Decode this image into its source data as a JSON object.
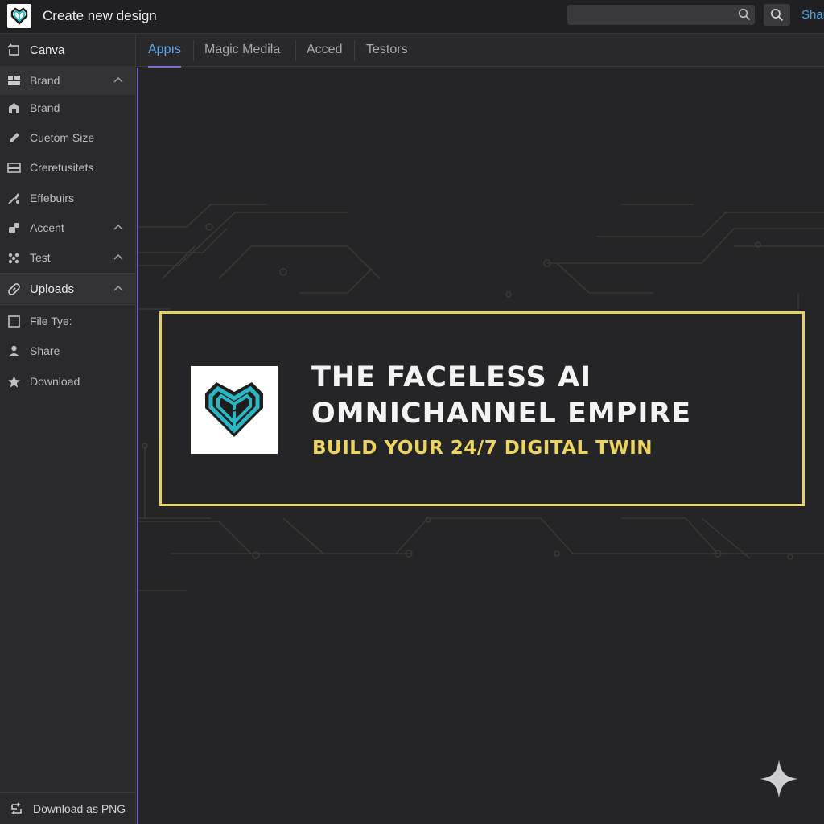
{
  "header": {
    "title": "Create new design",
    "search_placeholder": "",
    "share_label": "Shar"
  },
  "sidebar": {
    "items": [
      {
        "label": "Canva",
        "icon": "canva-icon"
      },
      {
        "label": "Brand",
        "icon": "brand-section-icon",
        "expanded": true
      },
      {
        "label": "Brand",
        "icon": "brand-kit-icon"
      },
      {
        "label": "Cuetom Size",
        "icon": "pencil-icon"
      },
      {
        "label": "Creretusitets",
        "icon": "layout-icon"
      },
      {
        "label": "Effebuirs",
        "icon": "effects-icon"
      },
      {
        "label": "Accent",
        "icon": "accent-icon",
        "expanded": true
      },
      {
        "label": "Test",
        "icon": "test-icon",
        "expanded": true
      },
      {
        "label": "Uploads",
        "icon": "uploads-icon",
        "expanded": true
      },
      {
        "label": "File Tye:",
        "icon": "file-icon"
      },
      {
        "label": "Share",
        "icon": "share-icon"
      },
      {
        "label": "Download",
        "icon": "star-icon"
      }
    ],
    "bottom_action": "Download as PNG"
  },
  "tabs": [
    {
      "label": "Appıs",
      "active": true
    },
    {
      "label": "Magic Medila",
      "active": false
    },
    {
      "label": "Acced",
      "active": false
    },
    {
      "label": "Testors",
      "active": false
    }
  ],
  "banner": {
    "title_line1": "THE FACELESS AI",
    "title_line2": "OMNICHANNEL EMPIRE",
    "subtitle": "BUILD YOUR 24/7 DIGITAL TWIN"
  },
  "colors": {
    "accent_blue": "#5aa8ef",
    "banner_border": "#e5d160",
    "subtitle_yellow": "#ecd461",
    "logo_teal": "#2ab7c4",
    "tab_underline": "#7f6cd6"
  }
}
